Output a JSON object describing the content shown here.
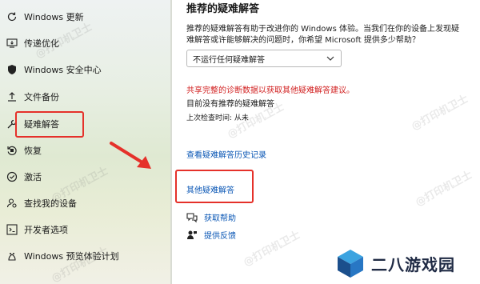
{
  "sidebar": {
    "items": [
      {
        "label": "Windows 更新",
        "icon": "refresh-icon"
      },
      {
        "label": "传递优化",
        "icon": "delivery-optimization-icon"
      },
      {
        "label": "Windows 安全中心",
        "icon": "shield-icon"
      },
      {
        "label": "文件备份",
        "icon": "upload-icon"
      },
      {
        "label": "疑难解答",
        "icon": "wrench-icon"
      },
      {
        "label": "恢复",
        "icon": "recovery-icon"
      },
      {
        "label": "激活",
        "icon": "check-circle-icon"
      },
      {
        "label": "查找我的设备",
        "icon": "person-locate-icon"
      },
      {
        "label": "开发者选项",
        "icon": "developer-icon"
      },
      {
        "label": "Windows 预览体验计划",
        "icon": "insider-icon"
      }
    ]
  },
  "main": {
    "title": "推荐的疑难解答",
    "description": "推荐的疑难解答有助于改进你的 Windows 体验。当我们在你的设备上发现疑难解答或许能够解决的问题时，你希望 Microsoft 提供多少帮助？",
    "dropdown_value": "不运行任何疑难解答",
    "warning": "共享完整的诊断数据以获取其他疑难解答建议。",
    "no_recommended": "目前没有推荐的疑难解答",
    "last_checked": "上次检查时间: 从未",
    "history_link": "查看疑难解答历史记录",
    "other_link": "其他疑难解答",
    "get_help": "获取帮助",
    "give_feedback": "提供反馈"
  },
  "watermark": "@打印机卫士",
  "logo": {
    "text": "二八游戏园"
  },
  "colors": {
    "accent": "#005fb8",
    "link": "#0b57b5",
    "warning": "#d11f1f",
    "highlight": "#e5312a"
  }
}
